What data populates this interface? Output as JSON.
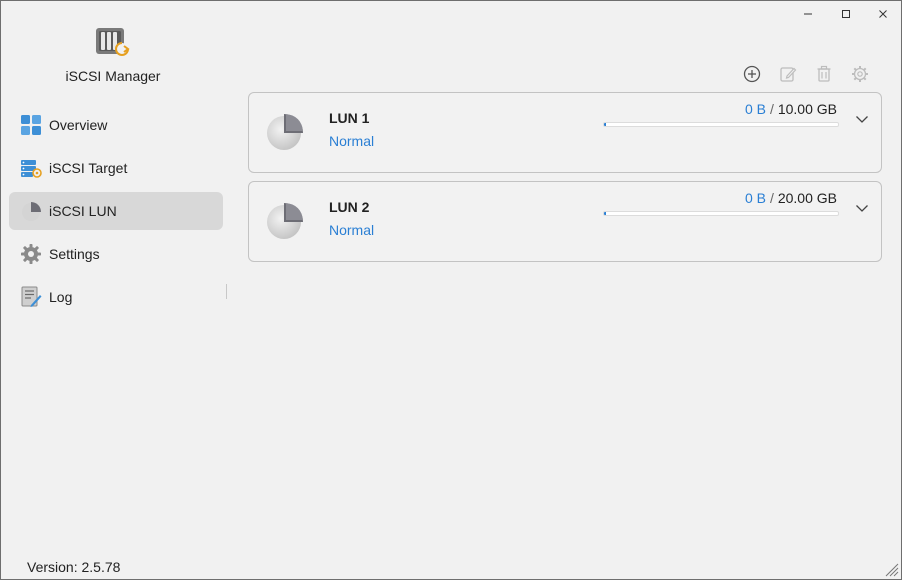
{
  "window": {
    "controls": {
      "minimize": "minimize-icon",
      "maximize": "maximize-icon",
      "close": "close-icon"
    }
  },
  "sidebar": {
    "app_name": "iSCSI Manager",
    "app_icon": "iscsi-manager-logo",
    "items": [
      {
        "label": "Overview",
        "icon": "overview-grid-icon",
        "active": false
      },
      {
        "label": "iSCSI Target",
        "icon": "target-server-icon",
        "active": false
      },
      {
        "label": "iSCSI LUN",
        "icon": "lun-pie-icon",
        "active": true
      },
      {
        "label": "Settings",
        "icon": "gear-icon",
        "active": false
      },
      {
        "label": "Log",
        "icon": "log-document-icon",
        "active": false
      }
    ],
    "version": "Version: 2.5.78"
  },
  "toolbar": {
    "buttons": [
      {
        "name": "add",
        "icon": "plus-circle-icon",
        "enabled": true
      },
      {
        "name": "edit",
        "icon": "edit-icon",
        "enabled": false
      },
      {
        "name": "delete",
        "icon": "trash-icon",
        "enabled": false
      },
      {
        "name": "settings",
        "icon": "gear-icon",
        "enabled": false
      }
    ]
  },
  "luns": [
    {
      "name": "LUN 1",
      "status": "Normal",
      "used": "0 B",
      "separator": "/",
      "total": "10.00 GB",
      "usage_fraction": 0.0
    },
    {
      "name": "LUN 2",
      "status": "Normal",
      "used": "0 B",
      "separator": "/",
      "total": "20.00 GB",
      "usage_fraction": 0.0
    }
  ],
  "colors": {
    "accent": "#2a7fd4",
    "active_nav": "#d8d8d8",
    "logo_orange": "#e6a020"
  }
}
